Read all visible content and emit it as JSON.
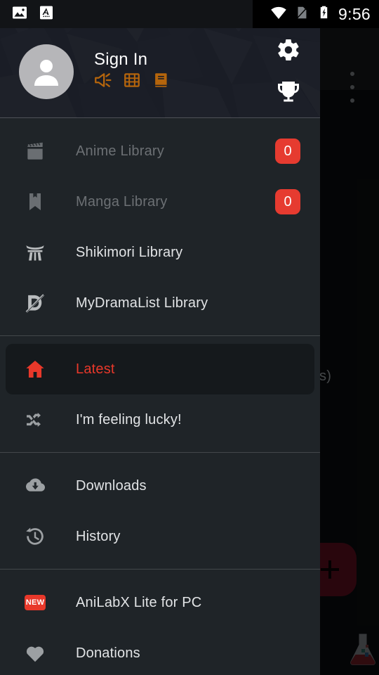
{
  "status_bar": {
    "left_icons": [
      "image-icon",
      "translate-icon"
    ],
    "right_icons": [
      "wifi-icon",
      "sim-card-icon",
      "battery-charging-icon"
    ],
    "clock": "9:56"
  },
  "drawer": {
    "header": {
      "avatar": "default-user-avatar",
      "account_name": "Sign In",
      "badges": [
        {
          "name": "announcement-icon",
          "color": "#b5650c"
        },
        {
          "name": "film-strip-icon",
          "color": "#b5650c"
        },
        {
          "name": "book-icon",
          "color": "#b5650c"
        }
      ],
      "actions": [
        {
          "name": "settings-gear-icon",
          "label": "Settings"
        },
        {
          "name": "trophy-icon",
          "label": "Achievements"
        }
      ]
    },
    "groups": [
      {
        "items": [
          {
            "icon": "clapperboard-icon",
            "label": "Anime Library",
            "badge": "0",
            "state": "disabled"
          },
          {
            "icon": "bookmark-icon",
            "label": "Manga Library",
            "badge": "0",
            "state": "disabled"
          },
          {
            "icon": "shikimori-torii-icon",
            "label": "Shikimori Library",
            "badge": null,
            "state": "normal"
          },
          {
            "icon": "mydramalist-icon",
            "label": "MyDramaList Library",
            "badge": null,
            "state": "normal"
          }
        ]
      },
      {
        "items": [
          {
            "icon": "home-icon",
            "label": "Latest",
            "badge": null,
            "state": "selected"
          },
          {
            "icon": "shuffle-icon",
            "label": "I'm feeling lucky!",
            "badge": null,
            "state": "normal"
          }
        ]
      },
      {
        "items": [
          {
            "icon": "download-cloud-icon",
            "label": "Downloads",
            "badge": null,
            "state": "normal"
          },
          {
            "icon": "history-clock-icon",
            "label": "History",
            "badge": null,
            "state": "normal"
          }
        ]
      },
      {
        "items": [
          {
            "icon": "new-badge-icon",
            "label": "AniLabX Lite for PC",
            "badge": null,
            "state": "normal"
          },
          {
            "icon": "heart-icon",
            "label": "Donations",
            "badge": null,
            "state": "normal"
          }
        ]
      }
    ]
  },
  "background_app": {
    "overflow_menu": "overflow-menu-icon",
    "partial_text": "s)",
    "fab": {
      "name": "add-fab",
      "label": "+"
    },
    "watermark": "flask-logo-icon"
  },
  "colors": {
    "accent_red": "#e8382a",
    "badge_red": "#e63b30",
    "orange": "#b5650c",
    "drawer_bg": "#1f2428",
    "header_bg": "#1a1d26"
  }
}
